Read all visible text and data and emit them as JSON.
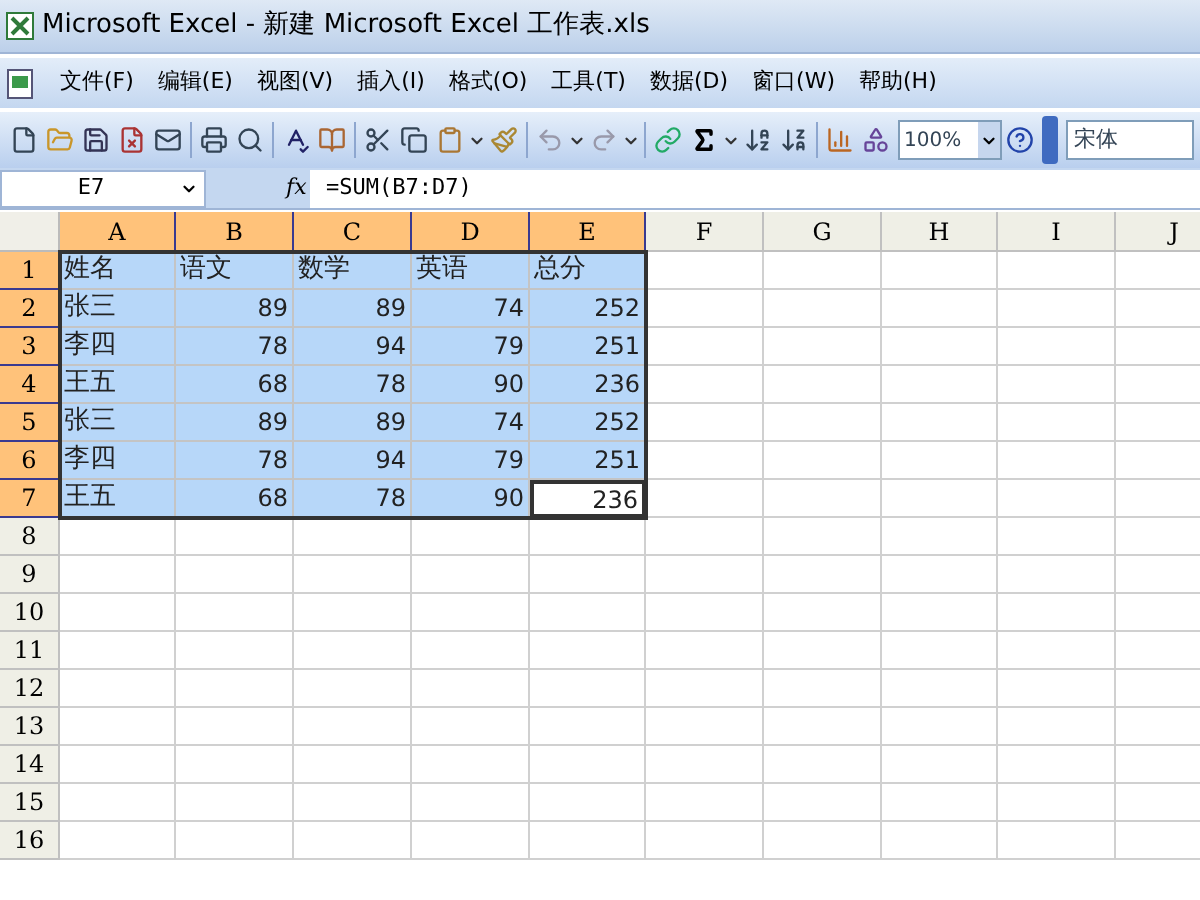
{
  "window": {
    "title": "Microsoft Excel - 新建 Microsoft Excel 工作表.xls"
  },
  "menu": [
    "文件(F)",
    "编辑(E)",
    "视图(V)",
    "插入(I)",
    "格式(O)",
    "工具(T)",
    "数据(D)",
    "窗口(W)",
    "帮助(H)"
  ],
  "toolbar": {
    "zoom": "100%",
    "font": "宋体"
  },
  "formula_bar": {
    "name_box": "E7",
    "fx": "fx",
    "formula": "=SUM(B7:D7)"
  },
  "columns": [
    {
      "label": "A",
      "selected": true
    },
    {
      "label": "B",
      "selected": true
    },
    {
      "label": "C",
      "selected": true
    },
    {
      "label": "D",
      "selected": true
    },
    {
      "label": "E",
      "selected": true
    },
    {
      "label": "F",
      "selected": false
    },
    {
      "label": "G",
      "selected": false
    },
    {
      "label": "H",
      "selected": false
    },
    {
      "label": "I",
      "selected": false
    },
    {
      "label": "J",
      "selected": false
    }
  ],
  "rows": [
    {
      "label": "1",
      "selected": true,
      "cells": [
        {
          "text": "姓名",
          "kind": "text",
          "active": false
        },
        {
          "text": "语文",
          "kind": "text",
          "active": false
        },
        {
          "text": "数学",
          "kind": "text",
          "active": false
        },
        {
          "text": "英语",
          "kind": "text",
          "active": false
        },
        {
          "text": "总分",
          "kind": "text",
          "active": false
        }
      ]
    },
    {
      "label": "2",
      "selected": true,
      "cells": [
        {
          "text": "张三",
          "kind": "text",
          "active": false
        },
        {
          "text": "89",
          "kind": "number",
          "active": false
        },
        {
          "text": "89",
          "kind": "number",
          "active": false
        },
        {
          "text": "74",
          "kind": "number",
          "active": false
        },
        {
          "text": "252",
          "kind": "number",
          "active": false
        }
      ]
    },
    {
      "label": "3",
      "selected": true,
      "cells": [
        {
          "text": "李四",
          "kind": "text",
          "active": false
        },
        {
          "text": "78",
          "kind": "number",
          "active": false
        },
        {
          "text": "94",
          "kind": "number",
          "active": false
        },
        {
          "text": "79",
          "kind": "number",
          "active": false
        },
        {
          "text": "251",
          "kind": "number",
          "active": false
        }
      ]
    },
    {
      "label": "4",
      "selected": true,
      "cells": [
        {
          "text": "王五",
          "kind": "text",
          "active": false
        },
        {
          "text": "68",
          "kind": "number",
          "active": false
        },
        {
          "text": "78",
          "kind": "number",
          "active": false
        },
        {
          "text": "90",
          "kind": "number",
          "active": false
        },
        {
          "text": "236",
          "kind": "number",
          "active": false
        }
      ]
    },
    {
      "label": "5",
      "selected": true,
      "cells": [
        {
          "text": "张三",
          "kind": "text",
          "active": false
        },
        {
          "text": "89",
          "kind": "number",
          "active": false
        },
        {
          "text": "89",
          "kind": "number",
          "active": false
        },
        {
          "text": "74",
          "kind": "number",
          "active": false
        },
        {
          "text": "252",
          "kind": "number",
          "active": false
        }
      ]
    },
    {
      "label": "6",
      "selected": true,
      "cells": [
        {
          "text": "李四",
          "kind": "text",
          "active": false
        },
        {
          "text": "78",
          "kind": "number",
          "active": false
        },
        {
          "text": "94",
          "kind": "number",
          "active": false
        },
        {
          "text": "79",
          "kind": "number",
          "active": false
        },
        {
          "text": "251",
          "kind": "number",
          "active": false
        }
      ]
    },
    {
      "label": "7",
      "selected": true,
      "cells": [
        {
          "text": "王五",
          "kind": "text",
          "active": false
        },
        {
          "text": "68",
          "kind": "number",
          "active": false
        },
        {
          "text": "78",
          "kind": "number",
          "active": false
        },
        {
          "text": "90",
          "kind": "number",
          "active": false
        },
        {
          "text": "236",
          "kind": "number",
          "active": true
        }
      ]
    },
    {
      "label": "8",
      "selected": false
    },
    {
      "label": "9",
      "selected": false
    },
    {
      "label": "10",
      "selected": false
    },
    {
      "label": "11",
      "selected": false
    },
    {
      "label": "12",
      "selected": false
    },
    {
      "label": "13",
      "selected": false
    },
    {
      "label": "14",
      "selected": false
    },
    {
      "label": "15",
      "selected": false
    },
    {
      "label": "16",
      "selected": false
    }
  ]
}
